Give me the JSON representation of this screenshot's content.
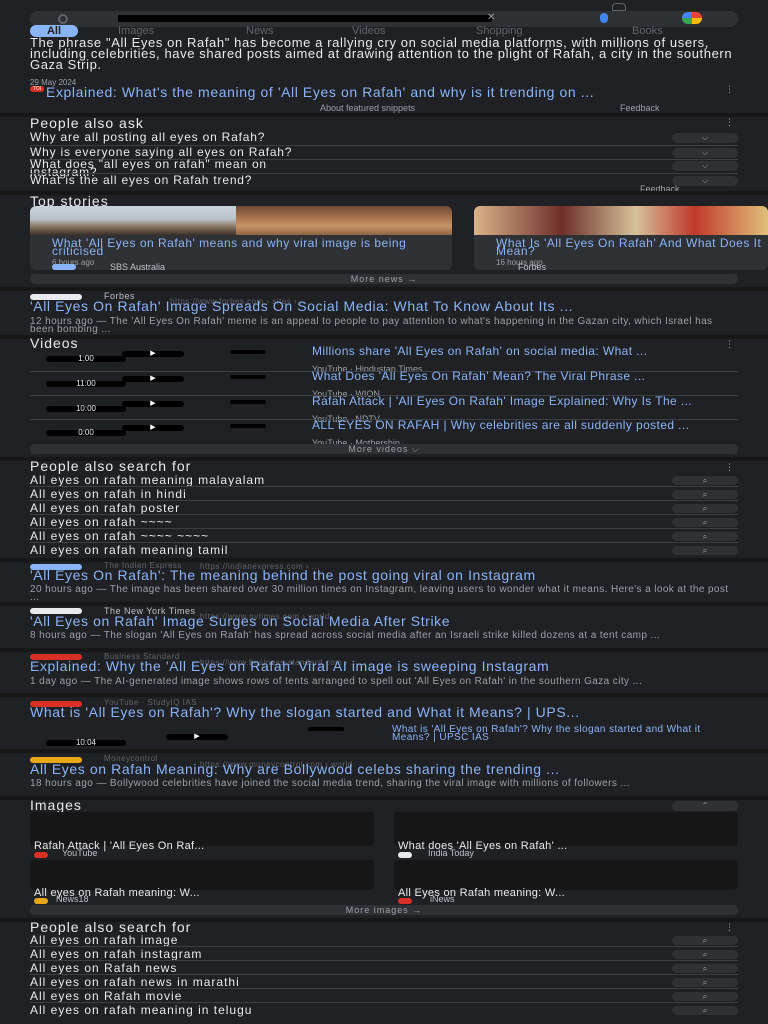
{
  "search": {
    "clear_glyph": "✕"
  },
  "tabs": [
    {
      "label": "All"
    },
    {
      "label": "Images"
    },
    {
      "label": "News"
    },
    {
      "label": "Videos"
    },
    {
      "label": "Shopping"
    },
    {
      "label": "Books"
    }
  ],
  "featured": {
    "snippet": "The phrase \"All Eyes on Rafah\" has become a rallying cry on social media platforms, with millions of users, including celebrities, have shared posts aimed at drawing attention to the plight of Rafah, a city in the southern Gaza Strip.",
    "date": "29 May 2024",
    "source_badge": "TOI",
    "title": "Explained: What's the meaning of 'All Eyes on Rafah' and why is it trending on ...",
    "about": "About featured snippets",
    "feedback": "Feedback"
  },
  "paa": {
    "title": "People also ask",
    "questions": [
      "Why are all posting all eyes on Rafah?",
      "Why is everyone saying all eyes on Rafah?",
      "What does \"all eyes on rafah\" mean on instagram?",
      "What is the all eyes on Rafah trend?"
    ],
    "chevron": "⌵",
    "feedback": "Feedback"
  },
  "top_stories": {
    "title": "Top stories",
    "cards": [
      {
        "title": "What 'All Eyes on Rafah' means and why viral image is being criticised",
        "time": "6 hours ago",
        "source": "SBS Australia"
      },
      {
        "title": "What Is 'All Eyes On Rafah' And What Does It Mean?",
        "time": "16 hours ago",
        "source": "Forbes"
      }
    ],
    "more": "More news  →"
  },
  "result_forbes": {
    "site": "Forbes",
    "url": "https://www.forbes.com › sites › ...",
    "title": "'All Eyes On Rafah' Image Spreads On Social Media: What To Know About Its ...",
    "desc": "12 hours ago — The 'All Eyes On Rafah' meme is an appeal to people to pay attention to what's happening in the Gazan city, which Israel has been bombing ..."
  },
  "videos": {
    "title": "Videos",
    "items": [
      {
        "duration": "1:00",
        "title": "Millions share 'All Eyes on Rafah' on social media: What ...",
        "meta": "YouTube · Hindustan Times"
      },
      {
        "duration": "11:00",
        "title": "What Does 'All Eyes On Rafah' Mean? The Viral Phrase ...",
        "meta": "YouTube · WION"
      },
      {
        "duration": "10:00",
        "title": "Rafah Attack | 'All Eyes On Rafah' Image Explained: Why Is The ...",
        "meta": "YouTube · NDTV"
      },
      {
        "duration": "0:00",
        "title": "ALL EYES ON RAFAH | Why celebrities are all suddenly posted ...",
        "meta": "YouTube · Mothership"
      }
    ],
    "play_glyph": "▶",
    "more": "More videos  ⌵"
  },
  "pasf1": {
    "title": "People also search for",
    "items": [
      "All eyes on rafah meaning malayalam",
      "All eyes on rafah in hindi",
      "All eyes on rafah poster",
      "All eyes on rafah ~~~~",
      "All eyes on rafah ~~~~ ~~~~",
      "All eyes on rafah meaning tamil"
    ],
    "search_glyph": "⌕"
  },
  "result_indianexpress": {
    "site": "The Indian Express",
    "url": "https://indianexpress.com › ...",
    "title": "'All Eyes On Rafah': The meaning behind the post going viral on Instagram",
    "desc": "20 hours ago — The image has been shared over 30 million times on Instagram, leaving users to wonder what it means. Here's a look at the post ..."
  },
  "result_nyt": {
    "site": "The New York Times",
    "url": "https://www.nytimes.com › world",
    "title": "'All Eyes on Rafah' Image Surges on Social Media After Strike",
    "desc": "8 hours ago — The slogan 'All Eyes on Rafah' has spread across social media after an Israeli strike killed dozens at a tent camp ..."
  },
  "result_bs": {
    "site": "Business Standard",
    "url": "https://www.business-standard.com › ...",
    "title": "Explained: Why the 'All Eyes on Rafah' Viral AI image is sweeping Instagram",
    "desc": "1 day ago — The AI-generated image shows rows of tents arranged to spell out 'All Eyes on Rafah' in the southern Gaza city ..."
  },
  "result_studyiq": {
    "site": "YouTube · StudyIQ IAS",
    "title": "What is 'All Eyes on Rafah'? Why the slogan started and What it Means? | UPS...",
    "duration": "10:04",
    "side": "What is 'All Eyes on Rafah'? Why the slogan started and What it Means? | UPSC IAS"
  },
  "result_moneycontrol": {
    "site": "Moneycontrol",
    "url": "https://www.moneycontrol.com › world",
    "title": "All Eyes on Rafah Meaning: Why are Bollywood celebs sharing the trending ...",
    "desc": "18 hours ago — Bollywood celebrities have joined the social media trend, sharing the viral image with millions of followers ..."
  },
  "images": {
    "title": "Images",
    "expand_glyph": "⌃",
    "cards": [
      {
        "caption": "Rafah Attack | 'All Eyes On Raf...",
        "source": "YouTube"
      },
      {
        "caption": "What does 'All Eyes on Rafah' ...",
        "source": "India Today"
      },
      {
        "caption": "All eyes on Rafah meaning: W...",
        "source": "News18"
      },
      {
        "caption": "All Eyes on Rafah meaning: W...",
        "source": "iNews"
      }
    ],
    "more": "More images  →"
  },
  "pasf2": {
    "title": "People also search for",
    "items": [
      "All eyes on rafah image",
      "All eyes on rafah instagram",
      "All eyes on Rafah news",
      "All eyes on rafah news in marathi",
      "All eyes on Rafah movie",
      "All eyes on rafah meaning in telugu"
    ],
    "search_glyph": "⌕"
  },
  "colors": {
    "link": "#8ab4f8",
    "text": "#e8eaed",
    "muted": "#9aa0a6",
    "bg": "#202124",
    "chip": "#303134"
  }
}
